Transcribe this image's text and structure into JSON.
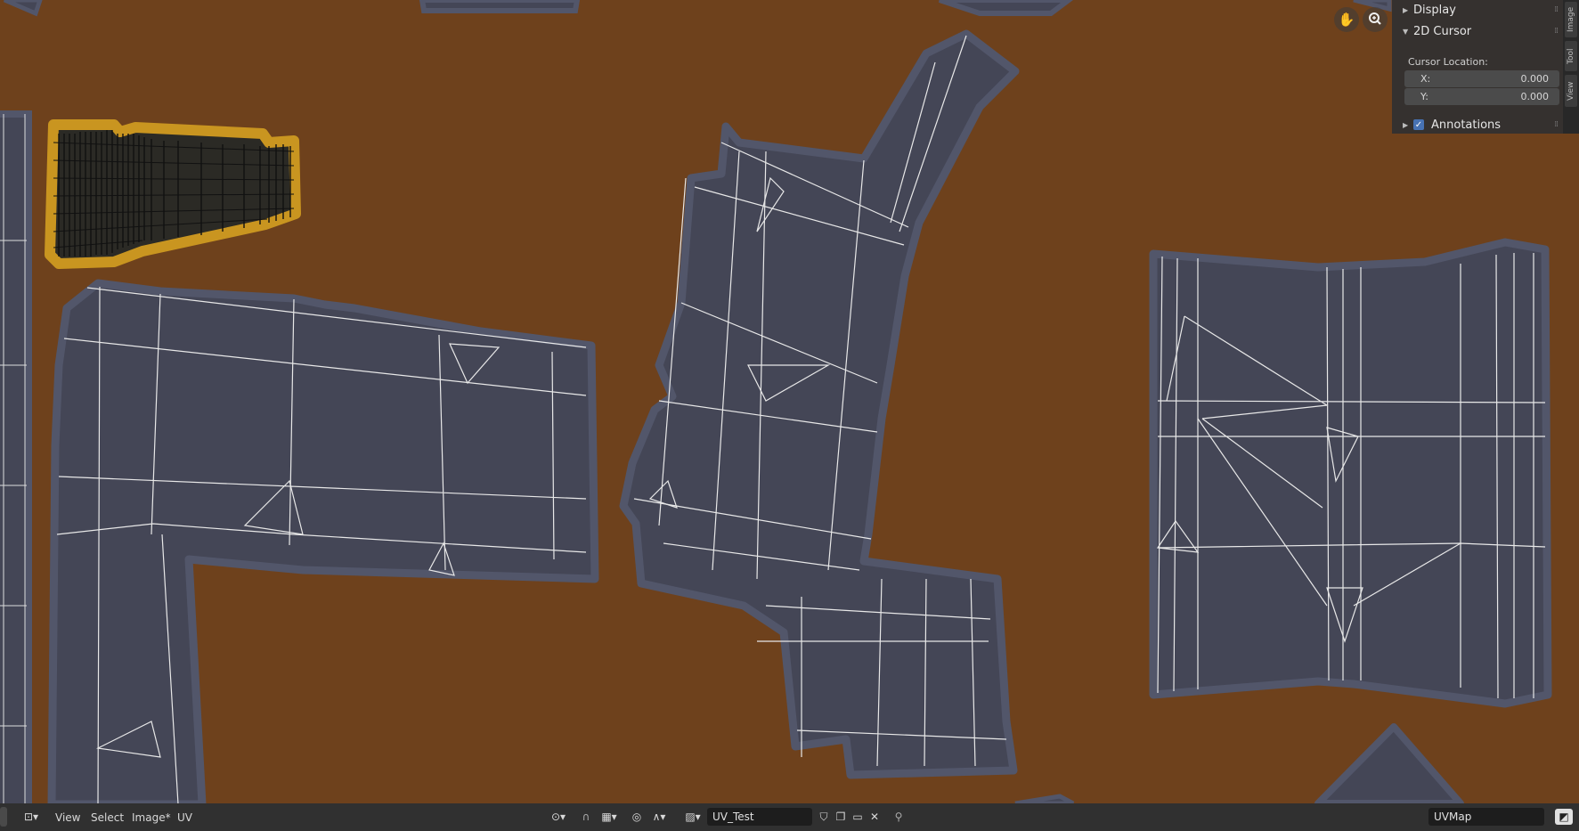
{
  "sidebar": {
    "display_label": "Display",
    "cursor_panel_label": "2D Cursor",
    "cursor_location_label": "Cursor Location:",
    "x_label": "X:",
    "x_value": "0.000",
    "y_label": "Y:",
    "y_value": "0.000",
    "annotations_label": "Annotations",
    "annotations_checked": true,
    "tabs": [
      "Image",
      "Tool",
      "View"
    ]
  },
  "header": {
    "menus": [
      "View",
      "Select",
      "Image*",
      "UV"
    ],
    "image_name": "UV_Test",
    "uv_map": "UVMap"
  },
  "colors": {
    "background": "#6e411c",
    "island_fill": "#444656",
    "island_outline": "#52566a",
    "selected_outline": "#c99520",
    "header": "#303030",
    "panel": "#303030"
  }
}
